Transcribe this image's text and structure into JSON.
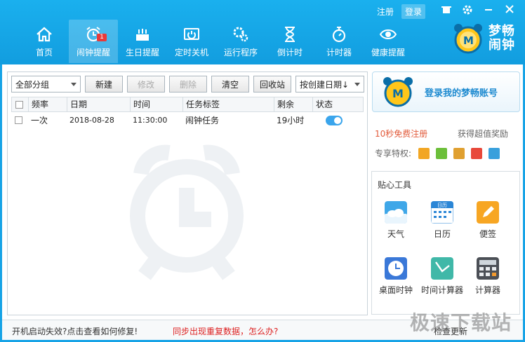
{
  "window": {
    "top_links": {
      "register": "注册",
      "login": "登录"
    },
    "controls": {
      "skin": "skin-icon",
      "settings": "gear-icon",
      "minimize": "minimize-icon",
      "close": "close-icon"
    }
  },
  "nav": {
    "items": [
      {
        "label": "首页",
        "icon": "home-icon"
      },
      {
        "label": "闹钟提醒",
        "icon": "alarm-clock-icon",
        "badge": "1"
      },
      {
        "label": "生日提醒",
        "icon": "cake-icon"
      },
      {
        "label": "定时关机",
        "icon": "power-icon"
      },
      {
        "label": "运行程序",
        "icon": "gears-icon"
      },
      {
        "label": "倒计时",
        "icon": "hourglass-icon"
      },
      {
        "label": "计时器",
        "icon": "stopwatch-icon"
      },
      {
        "label": "健康提醒",
        "icon": "eye-icon"
      }
    ],
    "active_index": 1
  },
  "brand": {
    "line1": "梦畅",
    "line2": "闹钟"
  },
  "toolbar": {
    "group_select": "全部分组",
    "new": "新建",
    "edit": "修改",
    "delete": "删除",
    "clear": "清空",
    "recycle": "回收站",
    "sort_select": "按创建日期↓"
  },
  "table": {
    "headers": [
      "频率",
      "日期",
      "时间",
      "任务标签",
      "剩余",
      "状态"
    ],
    "rows": [
      {
        "frequency": "一次",
        "date": "2018-08-28",
        "time": "11:30:00",
        "label": "闹钟任务",
        "remaining": "19小时",
        "enabled": true
      }
    ]
  },
  "account": {
    "login_card": "登录我的梦畅账号",
    "register_free": "10秒免费注册",
    "get_reward": "获得超值奖励",
    "privileges_label": "专享特权:"
  },
  "tools": {
    "title": "贴心工具",
    "items": [
      {
        "label": "天气",
        "icon": "weather-icon"
      },
      {
        "label": "日历",
        "icon": "calendar-icon",
        "icon_text": "日历"
      },
      {
        "label": "便签",
        "icon": "note-icon"
      },
      {
        "label": "桌面时钟",
        "icon": "desktop-clock-icon"
      },
      {
        "label": "时间计算器",
        "icon": "time-calculator-icon"
      },
      {
        "label": "计算器",
        "icon": "calculator-icon"
      }
    ]
  },
  "status": {
    "startup_fix": "开机启动失效?点击查看如何修复!",
    "sync_dup": "同步出现重复数据，怎么办?",
    "check_update": "检查更新",
    "watermark": "极速下载站"
  }
}
